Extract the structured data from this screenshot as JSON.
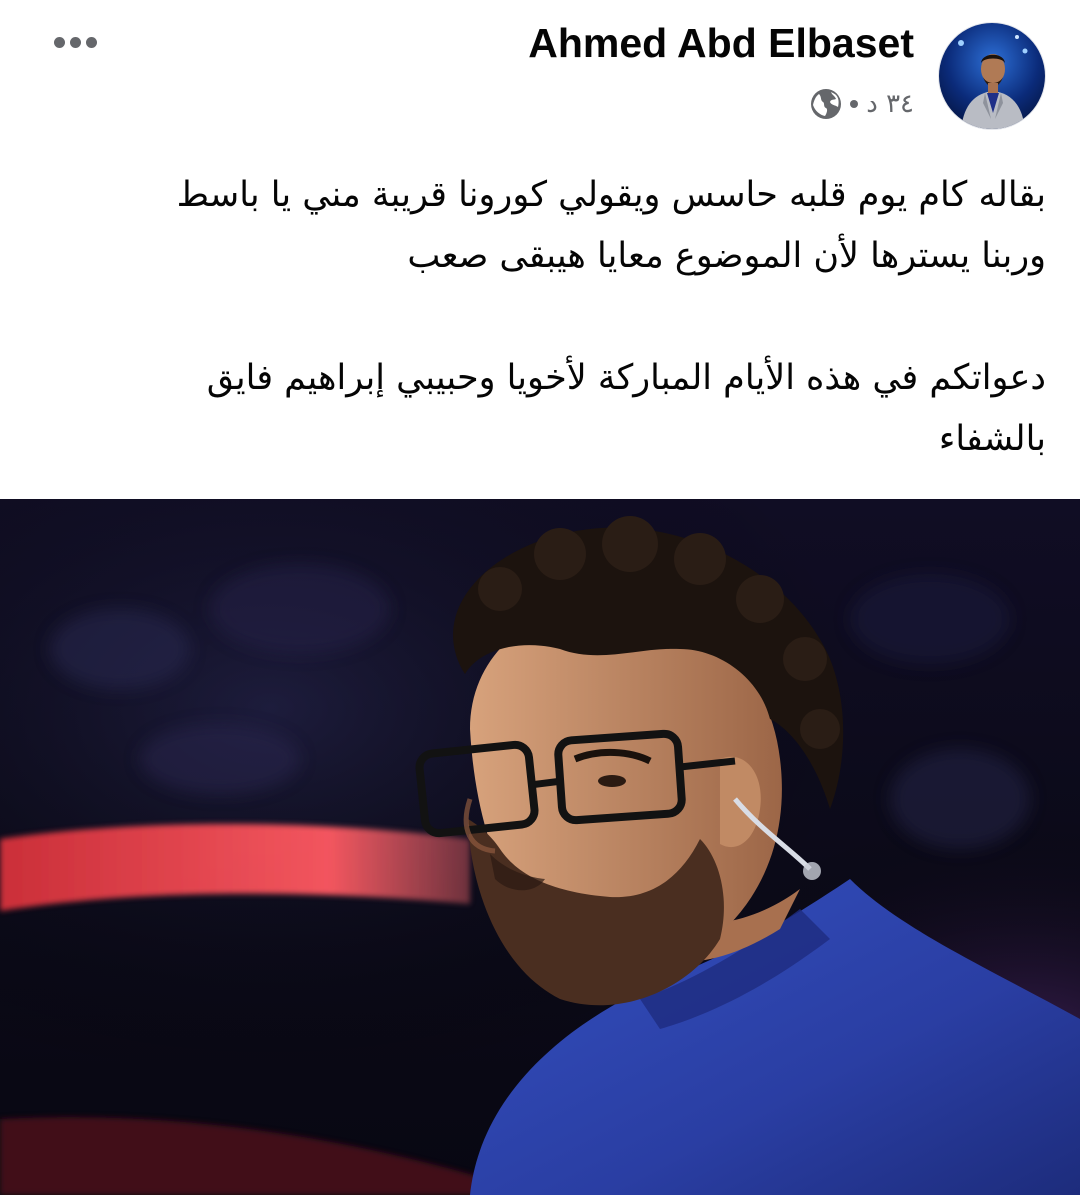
{
  "post": {
    "author_name": "Ahmed Abd Elbaset",
    "timestamp": "٣٤ د",
    "audience_icon": "globe-icon",
    "more_icon": "more-dots-icon",
    "text_lines": [
      "بقاله كام يوم قلبه حاسس ويقولي كورونا قريبة مني يا باسط",
      "وربنا يسترها لأن الموضوع معايا هيبقى صعب",
      "",
      "دعواتكم في هذه الأيام المباركة لأخويا وحبيبي إبراهيم فايق",
      "بالشفاء"
    ]
  },
  "colors": {
    "text_primary": "#050505",
    "text_secondary": "#65676b",
    "photo_background": "#0d0b1e",
    "photo_light_streak": "#e23a44",
    "jacket_blue": "#2c43a8"
  }
}
